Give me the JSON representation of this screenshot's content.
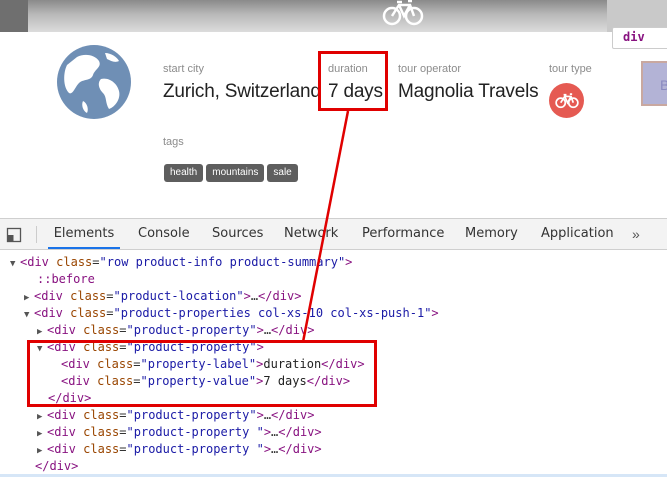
{
  "page": {
    "properties": [
      {
        "label": "start city",
        "value": "Zurich, Switzerland"
      },
      {
        "label": "duration",
        "value": "7 days"
      },
      {
        "label": "tour operator",
        "value": "Magnolia Travels"
      },
      {
        "label": "tour type",
        "value": ""
      }
    ],
    "tags_label": "tags",
    "tags": [
      "health",
      "mountains",
      "sale"
    ],
    "inspect_tooltip": "div",
    "inspect_overlay_text": "B"
  },
  "devtools": {
    "tabs": [
      "Elements",
      "Console",
      "Sources",
      "Network",
      "Performance",
      "Memory",
      "Application"
    ],
    "active_tab": "Elements",
    "more": "»",
    "dom": {
      "l1": {
        "tag": "div",
        "cls": "row product-info product-summary"
      },
      "l2": "::before",
      "l3": {
        "tag": "div",
        "cls": "product-location"
      },
      "l4": {
        "tag": "div",
        "cls": "product-properties col-xs-10 col-xs-push-1"
      },
      "l5": {
        "tag": "div",
        "cls": "product-property"
      },
      "l6": {
        "tag": "div",
        "cls": "product-property"
      },
      "l7": {
        "tag": "div",
        "cls": "property-label",
        "text": "duration"
      },
      "l8": {
        "tag": "div",
        "cls": "property-value",
        "text": "7 days"
      },
      "l9": "/div",
      "l10": {
        "tag": "div",
        "cls": "product-property"
      },
      "l11": {
        "tag": "div",
        "cls": "product-property "
      },
      "l12": {
        "tag": "div",
        "cls": "product-property "
      },
      "l13": "/div"
    },
    "ellipsis": "…"
  },
  "colors": {
    "annotation_red": "#e00000",
    "tour_type_badge": "#e55a52",
    "tag_bg": "#5e5e5e",
    "devtools_active_tab": "#1a73e8"
  },
  "icons": [
    "bicycle-icon",
    "globe-icon",
    "dock-side-icon",
    "more-tabs-icon"
  ]
}
